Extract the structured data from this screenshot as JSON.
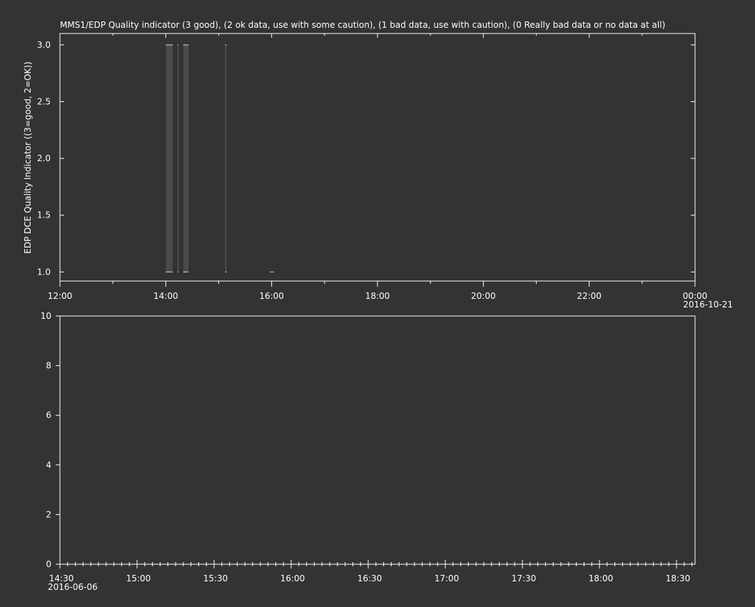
{
  "colors": {
    "background": "#333333",
    "foreground": "#ffffff",
    "data": "#4a4a4a"
  },
  "chart_data": [
    {
      "type": "line",
      "title": "MMS1/EDP  Quality indicator (3 good), (2 ok data, use with some caution), (1 bad data, use with caution), (0 Really bad data or no data at all)",
      "xlabel": "",
      "ylabel": "EDP DCE Quality Indicator ((3=good, 2=OK))",
      "x_unit": "hours since 12:00 (2016-10-20)",
      "xlim": [
        0,
        12
      ],
      "ylim": [
        0.92,
        3.1
      ],
      "y_ticks": [
        1.0,
        1.5,
        2.0,
        2.5,
        3.0
      ],
      "y_tick_labels": [
        "1.0",
        "1.5",
        "2.0",
        "2.5",
        "3.0"
      ],
      "x_tick_labels": [
        "12:00",
        "14:00",
        "16:00",
        "18:00",
        "20:00",
        "22:00",
        "00:00"
      ],
      "x_date_label": "2016-10-21",
      "grid": false,
      "series": [
        {
          "segments": [
            {
              "x0": 2.0,
              "x1": 2.13,
              "y0": 1,
              "y1": 3
            },
            {
              "x0": 2.22,
              "x1": 2.24,
              "y0": 1,
              "y1": 3
            },
            {
              "x0": 2.33,
              "x1": 2.43,
              "y0": 1,
              "y1": 3
            },
            {
              "x0": 3.12,
              "x1": 3.15,
              "y0": 1,
              "y1": 3
            },
            {
              "x0": 3.97,
              "x1": 4.04,
              "y0": 1,
              "y1": 1
            }
          ]
        }
      ]
    },
    {
      "type": "line",
      "title": "",
      "xlabel": "",
      "ylabel": "",
      "xlim": [
        "14:30",
        "18:37"
      ],
      "ylim": [
        0,
        10
      ],
      "y_ticks": [
        0,
        2,
        4,
        6,
        8,
        10
      ],
      "y_tick_labels": [
        "0",
        "2",
        "4",
        "6",
        "8",
        "10"
      ],
      "x_tick_labels": [
        "14:30",
        "15:00",
        "15:30",
        "16:00",
        "16:30",
        "17:00",
        "17:30",
        "18:00",
        "18:30"
      ],
      "x_date_label": "2016-06-06",
      "grid": false,
      "series": []
    }
  ]
}
